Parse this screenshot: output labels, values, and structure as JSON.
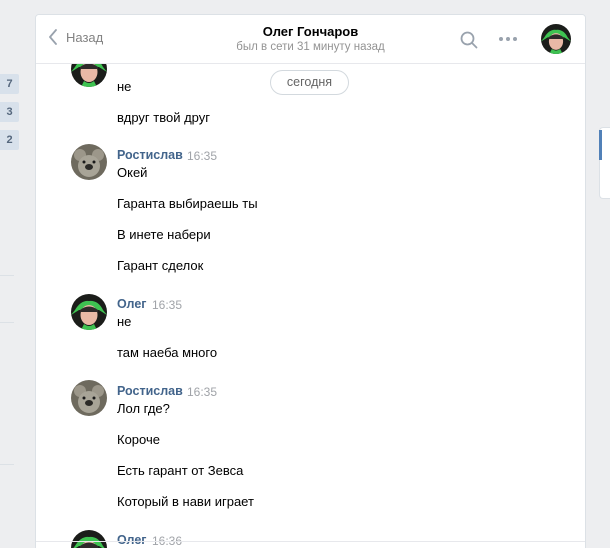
{
  "sidebar_counters": [
    "7",
    "3",
    "2"
  ],
  "header": {
    "back_label": "Назад",
    "title": "Олег Гончаров",
    "status": "был в сети 31 минуту назад",
    "search_icon": "search-icon",
    "more_icon": "more-icon"
  },
  "date_separator": "сегодня",
  "messages": [
    {
      "text": "не"
    },
    {
      "text": "вдруг твой друг"
    },
    {
      "author": "Ростислав",
      "time": "16:35"
    },
    {
      "text": "Окей"
    },
    {
      "text": "Гаранта выбираешь ты"
    },
    {
      "text": "В инете набери"
    },
    {
      "text": "Гарант сделок"
    },
    {
      "author": "Олег",
      "time": "16:35"
    },
    {
      "text": "не"
    },
    {
      "text": "там наеба много"
    },
    {
      "author": "Ростислав",
      "time": "16:35"
    },
    {
      "text": "Лол где?"
    },
    {
      "text": "Короче"
    },
    {
      "text": "Есть гарант от Зевса"
    },
    {
      "text": "Который в нави играет"
    },
    {
      "author": "Олег",
      "time": "16:36"
    }
  ],
  "colors": {
    "accent": "#5181b8",
    "author": "#42648b",
    "background": "#edeef0"
  }
}
